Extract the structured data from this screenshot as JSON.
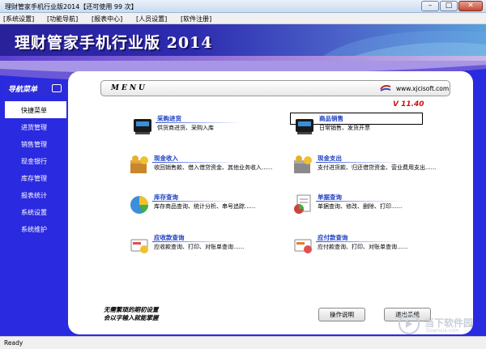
{
  "window": {
    "title": "理财管家手机行业版2014【还可使用 99 次】",
    "min": "–",
    "max": "□",
    "close": "✕"
  },
  "menubar": [
    "[系统设置]",
    "[功能导航]",
    "[报表中心]",
    "[人员设置]",
    "[软件注册]"
  ],
  "banner": {
    "title": "理财管家手机行业版 2014"
  },
  "nav": {
    "header": "导航菜单",
    "items": [
      "快捷菜单",
      "进货管理",
      "销售管理",
      "现金银行",
      "库存管理",
      "报表统计",
      "系统设置",
      "系统维护"
    ],
    "active_index": 0
  },
  "menu": {
    "label": "MENU",
    "site": "www.xjcisoft.com",
    "version": "V 11.40"
  },
  "tiles": [
    {
      "name": "采购进货",
      "desc": "供货商进货、采购入库",
      "icon": "cash-register-icon"
    },
    {
      "name": "商品销售",
      "desc": "日常销售、发货开票",
      "icon": "cash-register-icon"
    },
    {
      "name": "现金收入",
      "desc": "收回销售款、借入借贷资金、其他业务收入......",
      "icon": "money-chest-icon"
    },
    {
      "name": "现金支出",
      "desc": "支付进货款、归还借贷资金、营业费用支出......",
      "icon": "money-chest-icon"
    },
    {
      "name": "库存查询",
      "desc": "库存商品查询、统计分析、串号追踪......",
      "icon": "pie-chart-icon"
    },
    {
      "name": "单据查询",
      "desc": "单据查询、修改、删除、打印......",
      "icon": "document-chart-icon"
    },
    {
      "name": "应收款查询",
      "desc": "应收款查询、打印、对账单查询......",
      "icon": "receivables-icon"
    },
    {
      "name": "应付款查询",
      "desc": "应付款查询、打印、对账单查询......",
      "icon": "payables-icon"
    }
  ],
  "footer": {
    "note_line1": "无需繁琐的期初设置",
    "note_line2": "会以字输入就能掌握",
    "help": "操作说明",
    "exit": "退出系统"
  },
  "status": "Ready",
  "watermark": {
    "text": "当下软件园",
    "sub": "Downxia.com"
  },
  "colors": {
    "accent": "#2a2ae0",
    "link": "#1c3fbf",
    "version": "#d01010"
  }
}
